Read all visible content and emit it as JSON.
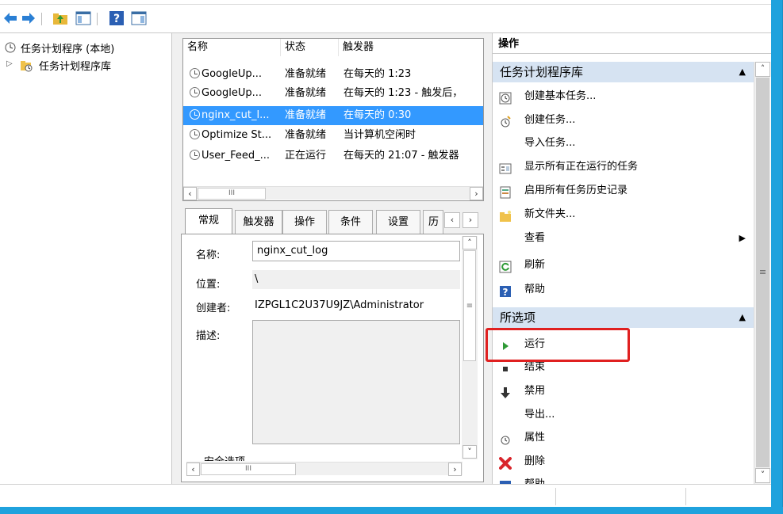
{
  "toolbar": {
    "buttons": [
      "back-icon",
      "forward-icon",
      "up-folder-icon",
      "show-hide-tree-icon",
      "help-icon",
      "show-hide-action-pane-icon"
    ]
  },
  "tree": {
    "root_label": "任务计划程序 (本地)",
    "child_label": "任务计划程序库"
  },
  "task_list": {
    "columns": [
      "名称",
      "状态",
      "触发器"
    ],
    "rows": [
      {
        "name": "GoogleUp...",
        "status": "准备就绪",
        "trigger": "在每天的 1:23"
      },
      {
        "name": "GoogleUp...",
        "status": "准备就绪",
        "trigger": "在每天的 1:23 - 触发后，"
      },
      {
        "name": "nginx_cut_l...",
        "status": "准备就绪",
        "trigger": "在每天的 0:30",
        "selected": true
      },
      {
        "name": "Optimize St...",
        "status": "准备就绪",
        "trigger": "当计算机空闲时"
      },
      {
        "name": "User_Feed_...",
        "status": "正在运行",
        "trigger": "在每天的 21:07 - 触发器"
      }
    ],
    "scroll_mid": "III"
  },
  "detail": {
    "tabs": [
      "常规",
      "触发器",
      "操作",
      "条件",
      "设置",
      "历"
    ],
    "name_label": "名称:",
    "name_value": "nginx_cut_log",
    "location_label": "位置:",
    "location_value": "\\",
    "author_label": "创建者:",
    "author_value": "IZPGL1C2U37U9JZ\\Administrator",
    "desc_label": "描述:",
    "security_label": "安全选项",
    "scroll_mid": "III",
    "vscroll_mid": "≡"
  },
  "actions": {
    "title": "操作",
    "section1": {
      "label": "任务计划程序库",
      "items": [
        {
          "icon": "create-basic-task-icon",
          "label": "创建基本任务..."
        },
        {
          "icon": "create-task-icon",
          "label": "创建任务..."
        },
        {
          "icon": "",
          "label": "导入任务..."
        },
        {
          "icon": "running-tasks-icon",
          "label": "显示所有正在运行的任务"
        },
        {
          "icon": "history-icon",
          "label": "启用所有任务历史记录"
        },
        {
          "icon": "new-folder-icon",
          "label": "新文件夹..."
        },
        {
          "icon": "",
          "label": "查看"
        },
        {
          "icon": "refresh-icon",
          "label": "刷新"
        },
        {
          "icon": "help-icon",
          "label": "帮助"
        }
      ]
    },
    "section2": {
      "label": "所选项",
      "items": [
        {
          "icon": "run-icon",
          "label": "运行"
        },
        {
          "icon": "end-icon",
          "label": "结束"
        },
        {
          "icon": "disable-icon",
          "label": "禁用"
        },
        {
          "icon": "",
          "label": "导出..."
        },
        {
          "icon": "properties-icon",
          "label": "属性"
        },
        {
          "icon": "delete-icon",
          "label": "删除"
        },
        {
          "icon": "help-icon",
          "label": "帮助"
        }
      ]
    },
    "scroll_mid": "≡"
  },
  "colors": {
    "selection": "#3399ff",
    "section_header": "#d6e3f2",
    "highlight": "#e02020",
    "frame": "#1fa2dd"
  }
}
